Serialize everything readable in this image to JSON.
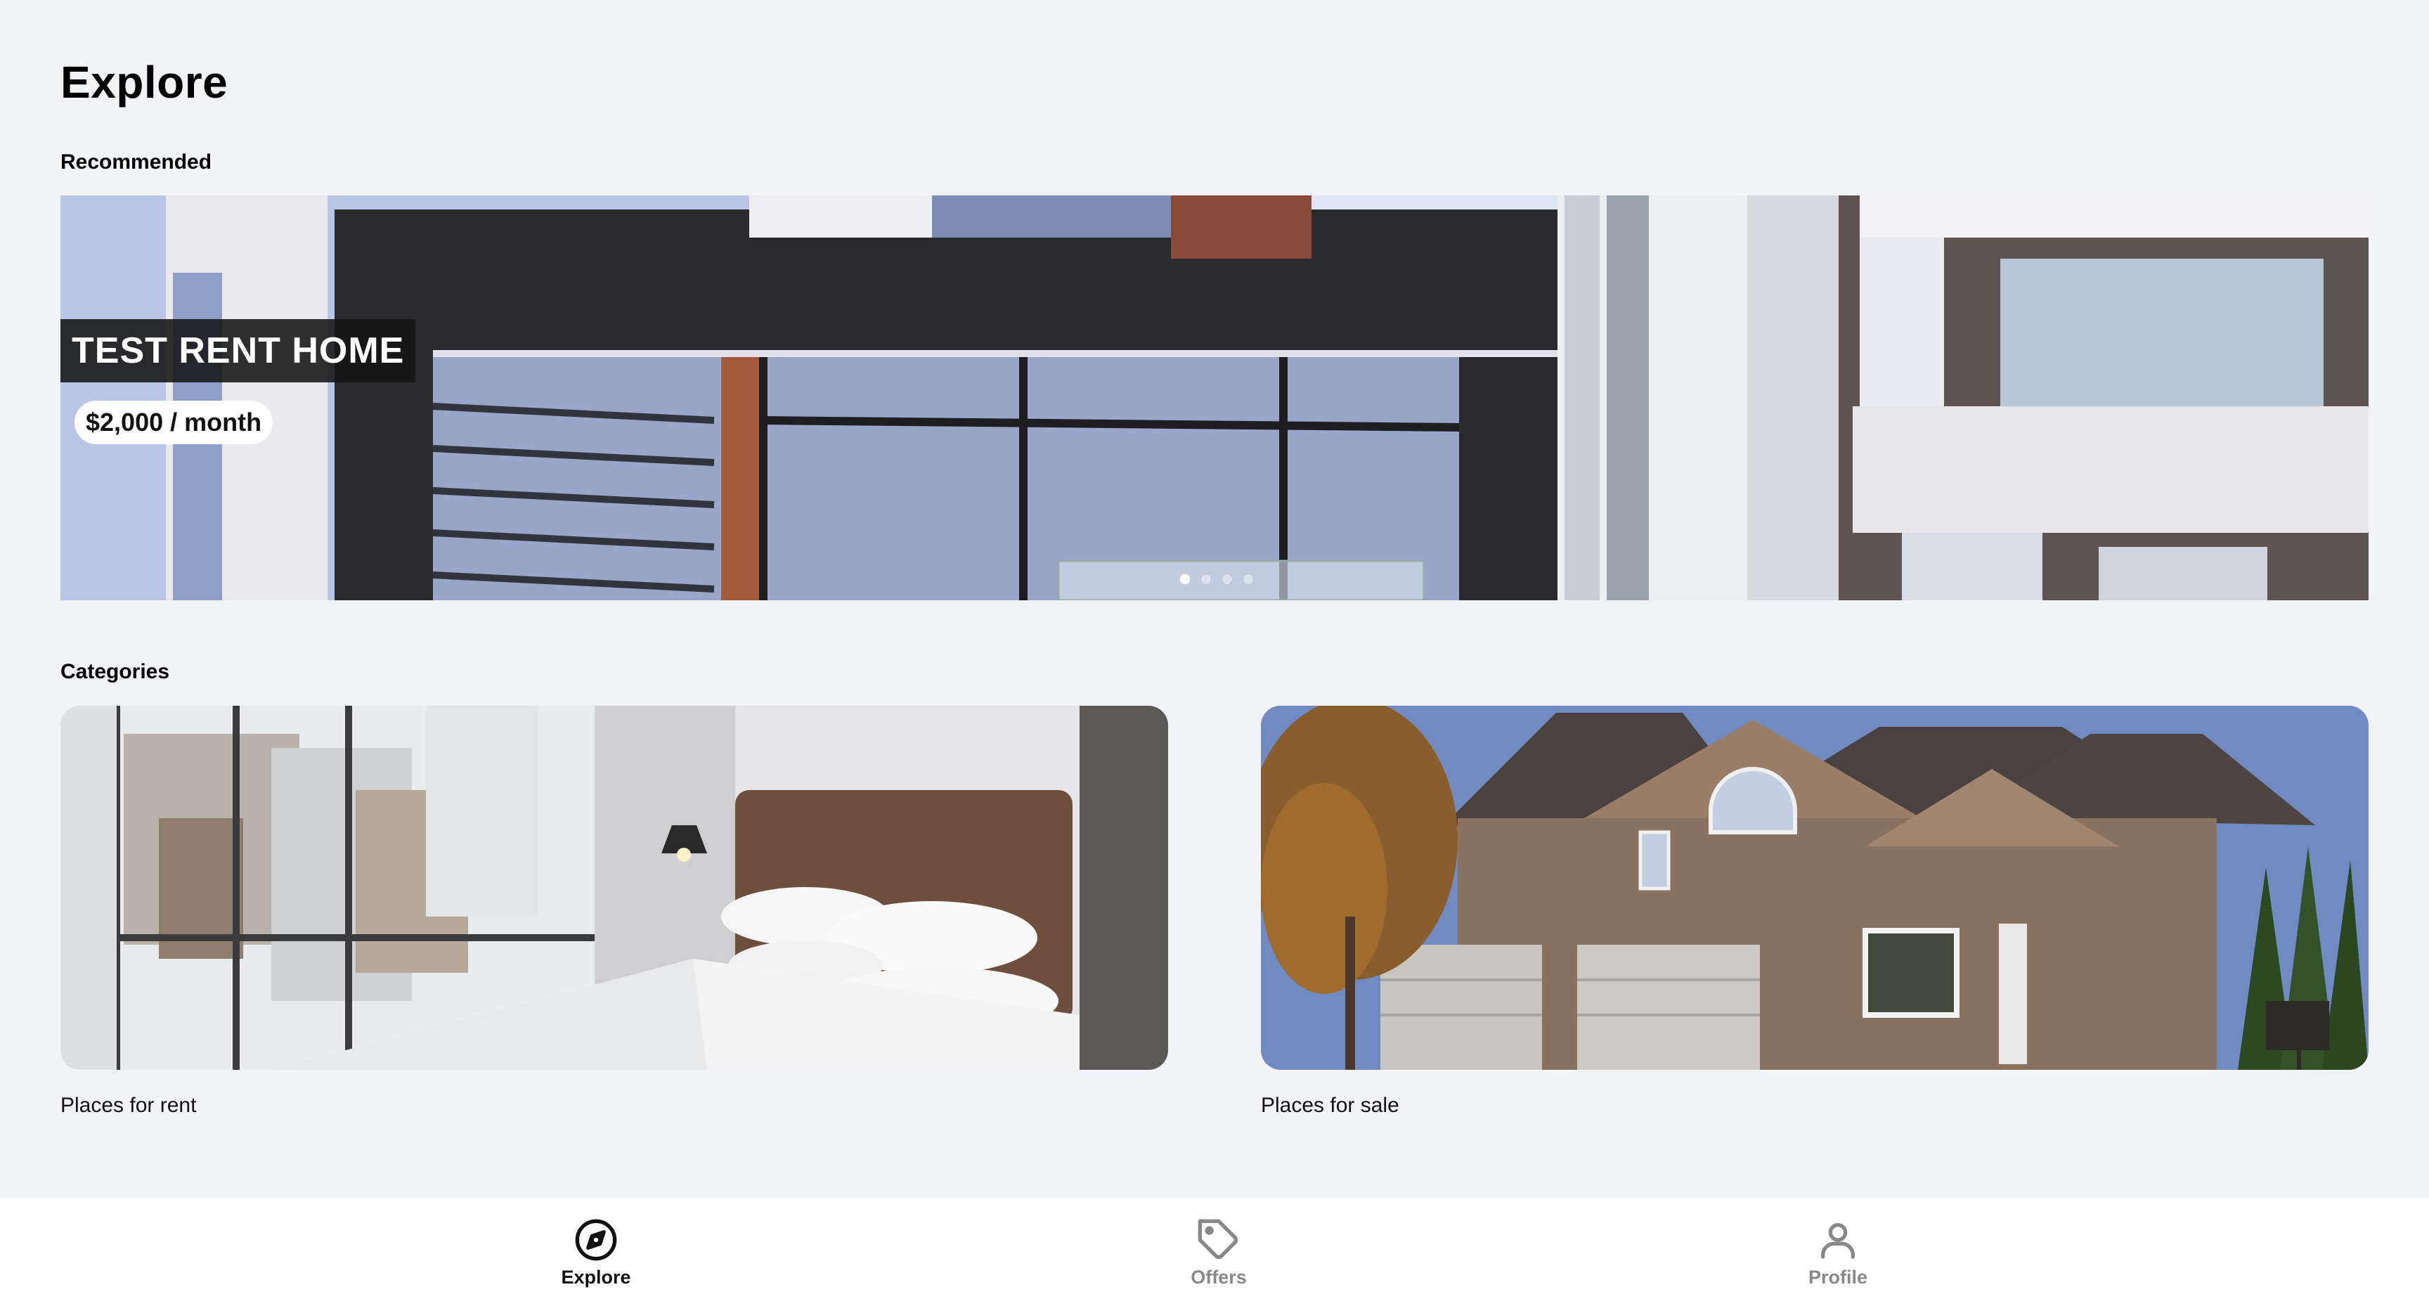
{
  "page": {
    "title": "Explore"
  },
  "recommended": {
    "label": "Recommended",
    "listing": {
      "title": "TEST RENT HOME",
      "price": "$2,000 / month"
    },
    "carousel": {
      "slide_count": 4,
      "active_index": 0
    }
  },
  "categories": {
    "label": "Categories",
    "items": [
      {
        "label": "Places for rent",
        "image": "bedroom-photo"
      },
      {
        "label": "Places for sale",
        "image": "house-exterior-photo"
      }
    ]
  },
  "bottom_nav": {
    "items": [
      {
        "label": "Explore",
        "icon": "compass-icon",
        "active": true
      },
      {
        "label": "Offers",
        "icon": "tag-icon",
        "active": false
      },
      {
        "label": "Profile",
        "icon": "person-icon",
        "active": false
      }
    ],
    "active_color": "#111111",
    "inactive_color": "#888888"
  }
}
